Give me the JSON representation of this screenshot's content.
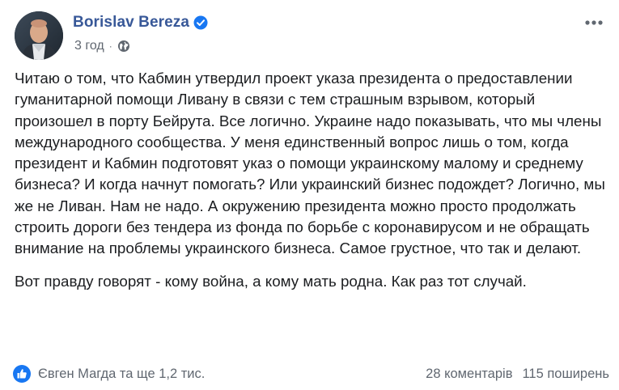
{
  "post": {
    "author": {
      "name": "Borislav Bereza",
      "verified": true
    },
    "timestamp": "3 год",
    "separator": "·",
    "audience_icon": "globe-icon",
    "more_icon": "more-options-icon",
    "body": {
      "paragraph_1": "Читаю о том, что Кабмин утвердил проект указа президента о предоставлении гуманитарной помощи Ливану в связи с тем страшным взрывом, который произошел в порту Бейрута. Все логично. Украине надо показывать, что мы члены международного сообщества. У меня единственный вопрос лишь о том, когда президент и Кабмин подготовят указ о помощи украинскому малому и среднему бизнеса? И когда начнут помогать? Или украинский бизнес подождет? Логично, мы же не Ливан. Нам не надо. А окружению президента можно просто продолжать строить дороги без тендера из фонда по борьбе с коронавирусом и не обращать внимание на проблемы украинского бизнеса. Самое грустное, что так и делают.",
      "paragraph_2": "Вот правду говорят - кому война, а кому мать родна. Как раз тот случай."
    },
    "footer": {
      "reactions_icon": "like-reaction-icon",
      "reactions_text": "Євген Магда та ще 1,2 тис.",
      "comments_text": "28 коментарів",
      "shares_text": "115 поширень"
    }
  },
  "colors": {
    "author_link": "#385898",
    "secondary_text": "#606770",
    "body_text": "#1c1e21",
    "like_blue": "#1877f2",
    "background": "#ffffff"
  }
}
